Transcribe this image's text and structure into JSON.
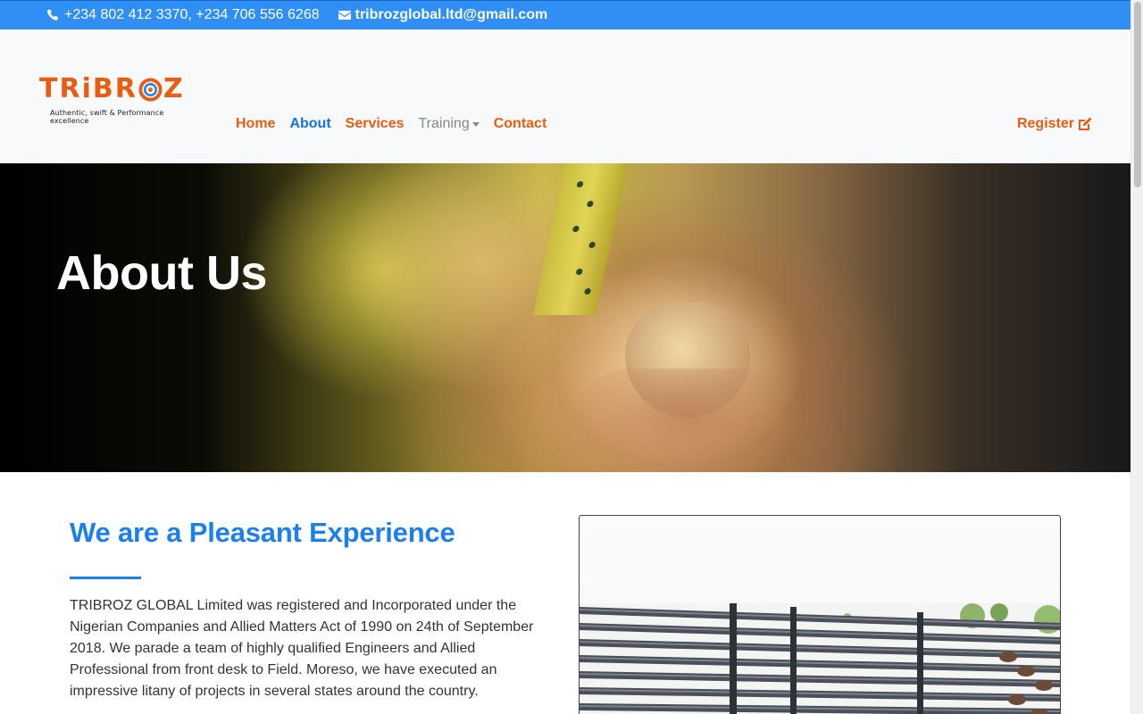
{
  "topbar": {
    "phone_icon": "phone-icon",
    "phones": "+234 802 412 3370, +234 706 556 6268",
    "email_icon": "envelope-icon",
    "email": "tribrozglobal.ltd@gmail.com"
  },
  "logo": {
    "word_left": "TRiBR",
    "word_right": "Z",
    "tagline": "Authentic, swift & Performance excellence"
  },
  "nav": {
    "items": [
      {
        "label": "Home"
      },
      {
        "label": "About"
      },
      {
        "label": "Services"
      },
      {
        "label": "Training"
      },
      {
        "label": "Contact"
      }
    ],
    "register_label": "Register",
    "register_icon": "edit-icon"
  },
  "hero": {
    "title": "About Us"
  },
  "intro": {
    "heading": "We are a Pleasant Experience",
    "paragraph": "TRIBROZ GLOBAL Limited was registered and Incorporated under the Nigerian Companies and Allied Matters Act of 1990 on 24th of September 2018. We parade a team of highly qualified Engineers and Allied Professional from front desk to Field. Moreso, we have executed an impressive litany of projects in several states around the country."
  },
  "colors": {
    "topbar": "#2f8ff4",
    "brand_orange": "#e85d12",
    "brand_blue": "#1c7ff0"
  }
}
